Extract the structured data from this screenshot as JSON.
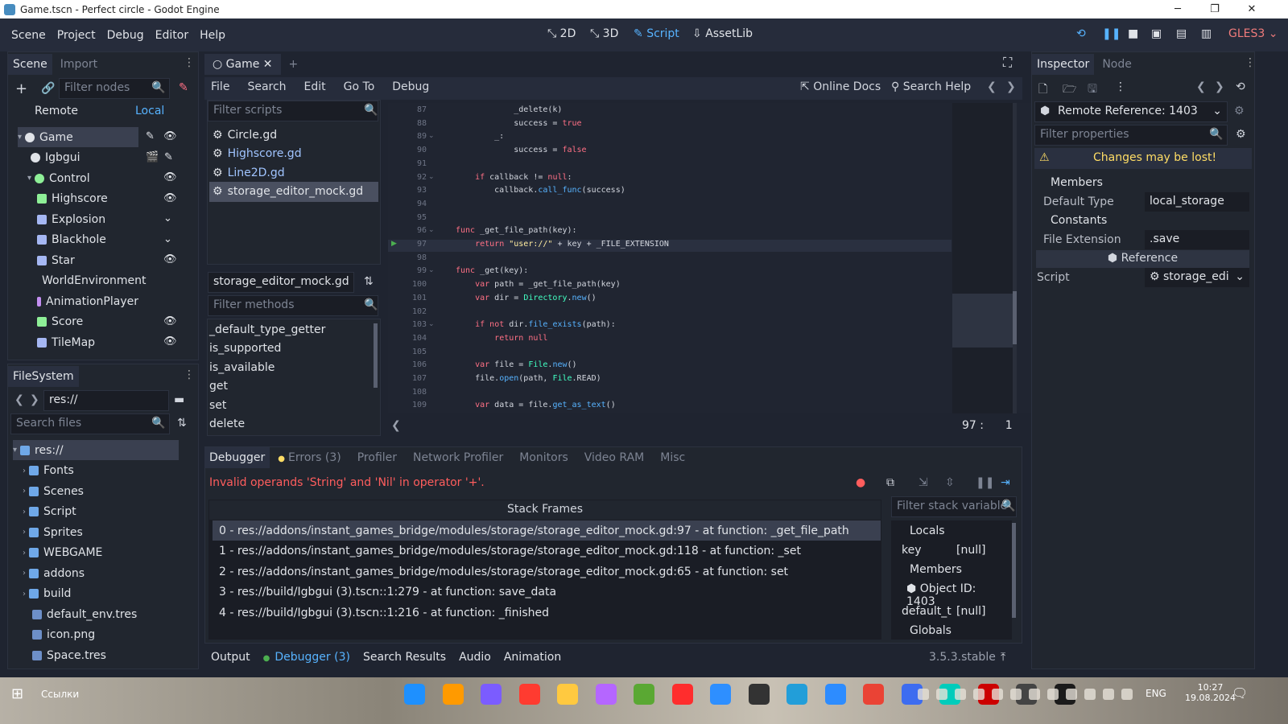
{
  "window": {
    "title": "Game.tscn - Perfect circle - Godot Engine"
  },
  "menu": {
    "items": [
      "Scene",
      "Project",
      "Debug",
      "Editor",
      "Help"
    ]
  },
  "workspaces": {
    "w2d": "2D",
    "w3d": "3D",
    "script": "Script",
    "assetlib": "AssetLib"
  },
  "renderer": "GLES3",
  "scene_dock": {
    "tab": "Scene",
    "tab2": "Import",
    "filter": "Filter nodes",
    "remote": "Remote",
    "local": "Local",
    "nodes": [
      {
        "name": "Game",
        "depth": 0,
        "color": "#e0e3e8",
        "icon": "node-icon"
      },
      {
        "name": "Igbgui",
        "depth": 1,
        "color": "#e0e3e8",
        "icon": "node-icon"
      },
      {
        "name": "Control",
        "depth": 1,
        "color": "#8eef97",
        "icon": "control-icon"
      },
      {
        "name": "Highscore",
        "depth": 2,
        "color": "#8eef97",
        "icon": "label-icon"
      },
      {
        "name": "Explosion",
        "depth": 2,
        "color": "#a5b7f3",
        "icon": "sprite-icon"
      },
      {
        "name": "Blackhole",
        "depth": 2,
        "color": "#a5b7f3",
        "icon": "sprite-icon"
      },
      {
        "name": "Star",
        "depth": 2,
        "color": "#a5b7f3",
        "icon": "sprite-icon"
      },
      {
        "name": "WorldEnvironment",
        "depth": 2,
        "color": "#fc7f7f",
        "icon": "world-environment-icon"
      },
      {
        "name": "AnimationPlayer",
        "depth": 2,
        "color": "#c38ef1",
        "icon": "animation-player-icon"
      },
      {
        "name": "Score",
        "depth": 2,
        "color": "#8eef97",
        "icon": "label-icon"
      },
      {
        "name": "TileMap",
        "depth": 2,
        "color": "#a5b7f3",
        "icon": "tilemap-icon"
      }
    ]
  },
  "filesystem": {
    "tab": "FileSystem",
    "path": "res://",
    "search": "Search files",
    "items": [
      "res://",
      "Fonts",
      "Scenes",
      "Script",
      "Sprites",
      "WEBGAME",
      "addons",
      "build",
      "default_env.tres",
      "icon.png",
      "Space.tres"
    ]
  },
  "editor_tab": {
    "name": "Game"
  },
  "script_menu": {
    "items": [
      "File",
      "Search",
      "Edit",
      "Go To",
      "Debug"
    ],
    "online_docs": "Online Docs",
    "search_help": "Search Help"
  },
  "scripts": {
    "filter": "Filter scripts",
    "items": [
      "Circle.gd",
      "Highscore.gd",
      "Line2D.gd",
      "storage_editor_mock.gd"
    ],
    "current": "storage_editor_mock.gd",
    "filter_methods": "Filter methods",
    "methods": [
      "_default_type_getter",
      "is_supported",
      "is_available",
      "get",
      "set",
      "delete"
    ]
  },
  "code": {
    "lines": [
      {
        "n": "87",
        "t": "            _delete(k)"
      },
      {
        "n": "88",
        "t": "            success = true"
      },
      {
        "n": "89",
        "t": "        _:"
      },
      {
        "n": "90",
        "t": "            success = false"
      },
      {
        "n": "91",
        "t": ""
      },
      {
        "n": "92",
        "t": "    if callback != null:"
      },
      {
        "n": "93",
        "t": "        callback.call_func(success)"
      },
      {
        "n": "94",
        "t": ""
      },
      {
        "n": "95",
        "t": ""
      },
      {
        "n": "96",
        "t": "func _get_file_path(key):"
      },
      {
        "n": "97",
        "t": "    return \"user://\" + key + _FILE_EXTENSION"
      },
      {
        "n": "98",
        "t": ""
      },
      {
        "n": "99",
        "t": "func _get(key):"
      },
      {
        "n": "100",
        "t": "    var path = _get_file_path(key)"
      },
      {
        "n": "101",
        "t": "    var dir = Directory.new()"
      },
      {
        "n": "102",
        "t": ""
      },
      {
        "n": "103",
        "t": "    if not dir.file_exists(path):"
      },
      {
        "n": "104",
        "t": "        return null"
      },
      {
        "n": "105",
        "t": ""
      },
      {
        "n": "106",
        "t": "    var file = File.new()"
      },
      {
        "n": "107",
        "t": "    file.open(path, File.READ)"
      },
      {
        "n": "108",
        "t": ""
      },
      {
        "n": "109",
        "t": "    var data = file.get_as_text()"
      }
    ],
    "cursor_line": "97",
    "cursor_col": "1"
  },
  "debugger": {
    "tabs": [
      "Debugger",
      "Errors (3)",
      "Profiler",
      "Network Profiler",
      "Monitors",
      "Video RAM",
      "Misc"
    ],
    "error": "Invalid operands 'String' and 'Nil' in operator '+'.",
    "stack_title": "Stack Frames",
    "frames": [
      "0 - res://addons/instant_games_bridge/modules/storage/storage_editor_mock.gd:97 - at function: _get_file_path",
      "1 - res://addons/instant_games_bridge/modules/storage/storage_editor_mock.gd:118 - at function: _set",
      "2 - res://addons/instant_games_bridge/modules/storage/storage_editor_mock.gd:65 - at function: set",
      "3 - res://build/Igbgui (3).tscn::1:279 - at function: save_data",
      "4 - res://build/Igbgui (3).tscn::1:216 - at function: _finished"
    ],
    "filter_vars": "Filter stack variable",
    "locals": "Locals",
    "key_name": "key",
    "key_val": "[null]",
    "members": "Members",
    "object_id": "Object ID: 1403",
    "default_t": "default_t",
    "default_val": "[null]",
    "globals": "Globals"
  },
  "bottom_tabs": {
    "items": [
      "Output",
      "Debugger (3)",
      "Search Results",
      "Audio",
      "Animation"
    ],
    "version": "3.5.3.stable"
  },
  "inspector": {
    "tab": "Inspector",
    "tab2": "Node",
    "remote_ref": "Remote Reference: 1403",
    "filter": "Filter properties",
    "warning": "Changes may be lost!",
    "members": "Members",
    "default_type_label": "Default Type",
    "default_type_val": "local_storage",
    "constants": "Constants",
    "file_ext_label": "File Extension",
    "file_ext_val": ".save",
    "reference": "Reference",
    "script_label": "Script",
    "script_val": "storage_edi"
  },
  "taskbar": {
    "search": "Ссылки",
    "lang": "ENG",
    "time": "10:27",
    "date": "19.08.2024"
  }
}
